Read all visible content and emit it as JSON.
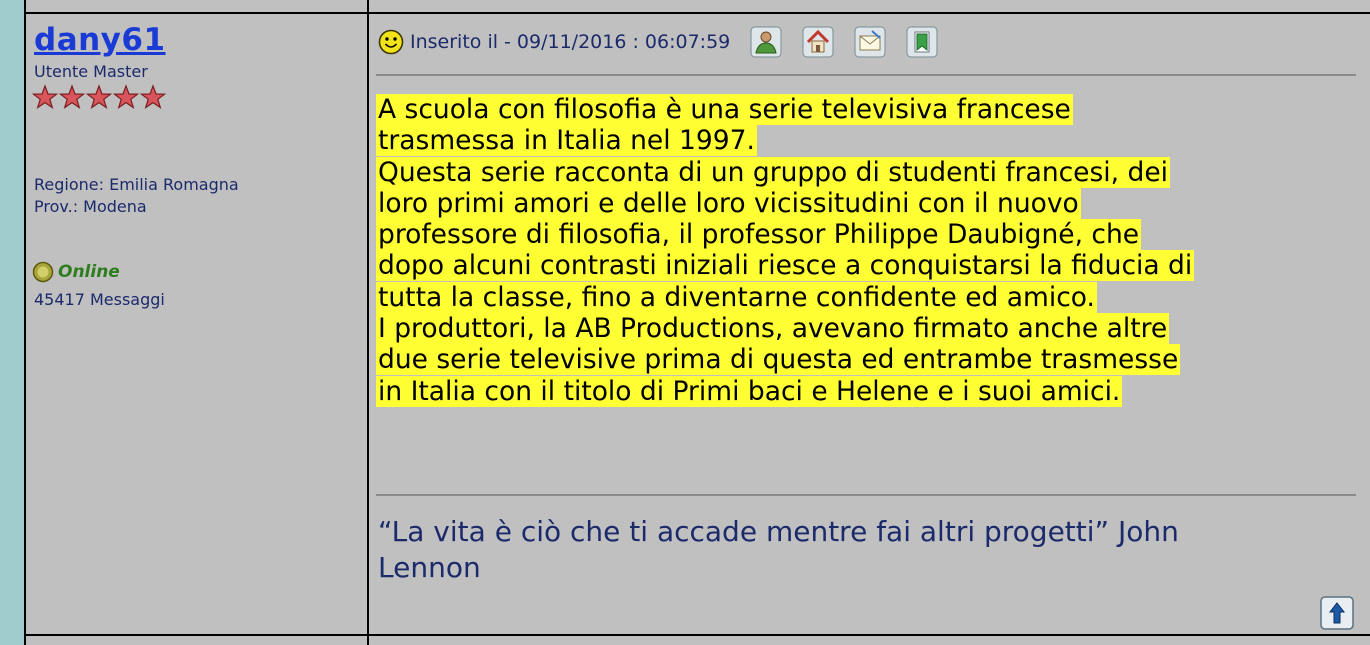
{
  "author": {
    "username": "dany61",
    "rank": "Utente Master",
    "stars": 5,
    "region": "Regione: Emilia Romagna",
    "province": "Prov.: Modena",
    "status": "Online",
    "message_count": "45417 Messaggi"
  },
  "post": {
    "posted_label": "Inserito il - 09/11/2016 : 06:07:59",
    "toolbar_icons": [
      "profile-icon",
      "home-icon",
      "email-icon",
      "bookmark-icon"
    ],
    "paragraphs": [
      [
        "A scuola con filosofia è una serie televisiva francese",
        "trasmessa in Italia nel 1997."
      ],
      [
        "Questa serie racconta di un gruppo di studenti francesi, dei",
        "loro primi amori e delle loro vicissitudini con il nuovo",
        "professore di filosofia, il professor Philippe Daubigné, che",
        "dopo alcuni contrasti iniziali riesce a conquistarsi la fiducia di",
        "tutta la classe, fino a diventarne confidente ed amico."
      ],
      [
        "I produttori, la AB Productions, avevano firmato anche altre",
        "due serie televisive prima di questa ed entrambe trasmesse",
        "in Italia con il titolo di Primi baci e Helene e i suoi amici."
      ]
    ],
    "signature_line1": "“La vita è ciò che ti accade mentre fai altri progetti” John",
    "signature_line2": "Lennon",
    "back_to_top": "go-to-top-icon"
  },
  "colors": {
    "highlight": "#ffff33",
    "username": "#1a3ad6",
    "panel": "#c0c0c0",
    "page_bg": "#9fcccc"
  }
}
